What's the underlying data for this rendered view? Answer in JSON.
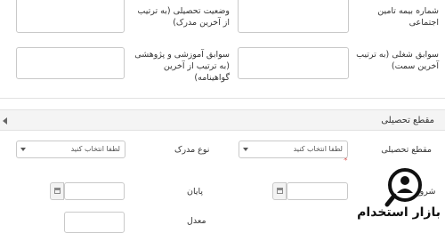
{
  "form": {
    "row1": {
      "right_label": "شماره بیمه تامین اجتماعی",
      "left_label": "وضعیت تحصیلی (به ترتیب از آخرین مدرک)"
    },
    "row2": {
      "right_label": "سوابق شغلی (به ترتیب آخرین سمت)",
      "left_label": "سوابق آموزشی و پژوهشی (به ترتیب از آخرین گواهینامه)"
    }
  },
  "section": {
    "title": "مقطع تحصیلی"
  },
  "education": {
    "degree_label": "مقطع تحصیلی",
    "degree_required_mark": "*",
    "degree_select_value": "لطفا انتخاب کنید",
    "doc_type_label": "نوع مدرک",
    "doc_type_select_value": "لطفا انتخاب کنید",
    "start_label": "شروع",
    "end_label": "پایان",
    "gpa_label": "معدل"
  },
  "watermark": {
    "text": "بازار استخدام"
  },
  "colors": {
    "border": "#c9c9c9",
    "section_bg": "#f4f4f4",
    "required": "#d9534f"
  }
}
